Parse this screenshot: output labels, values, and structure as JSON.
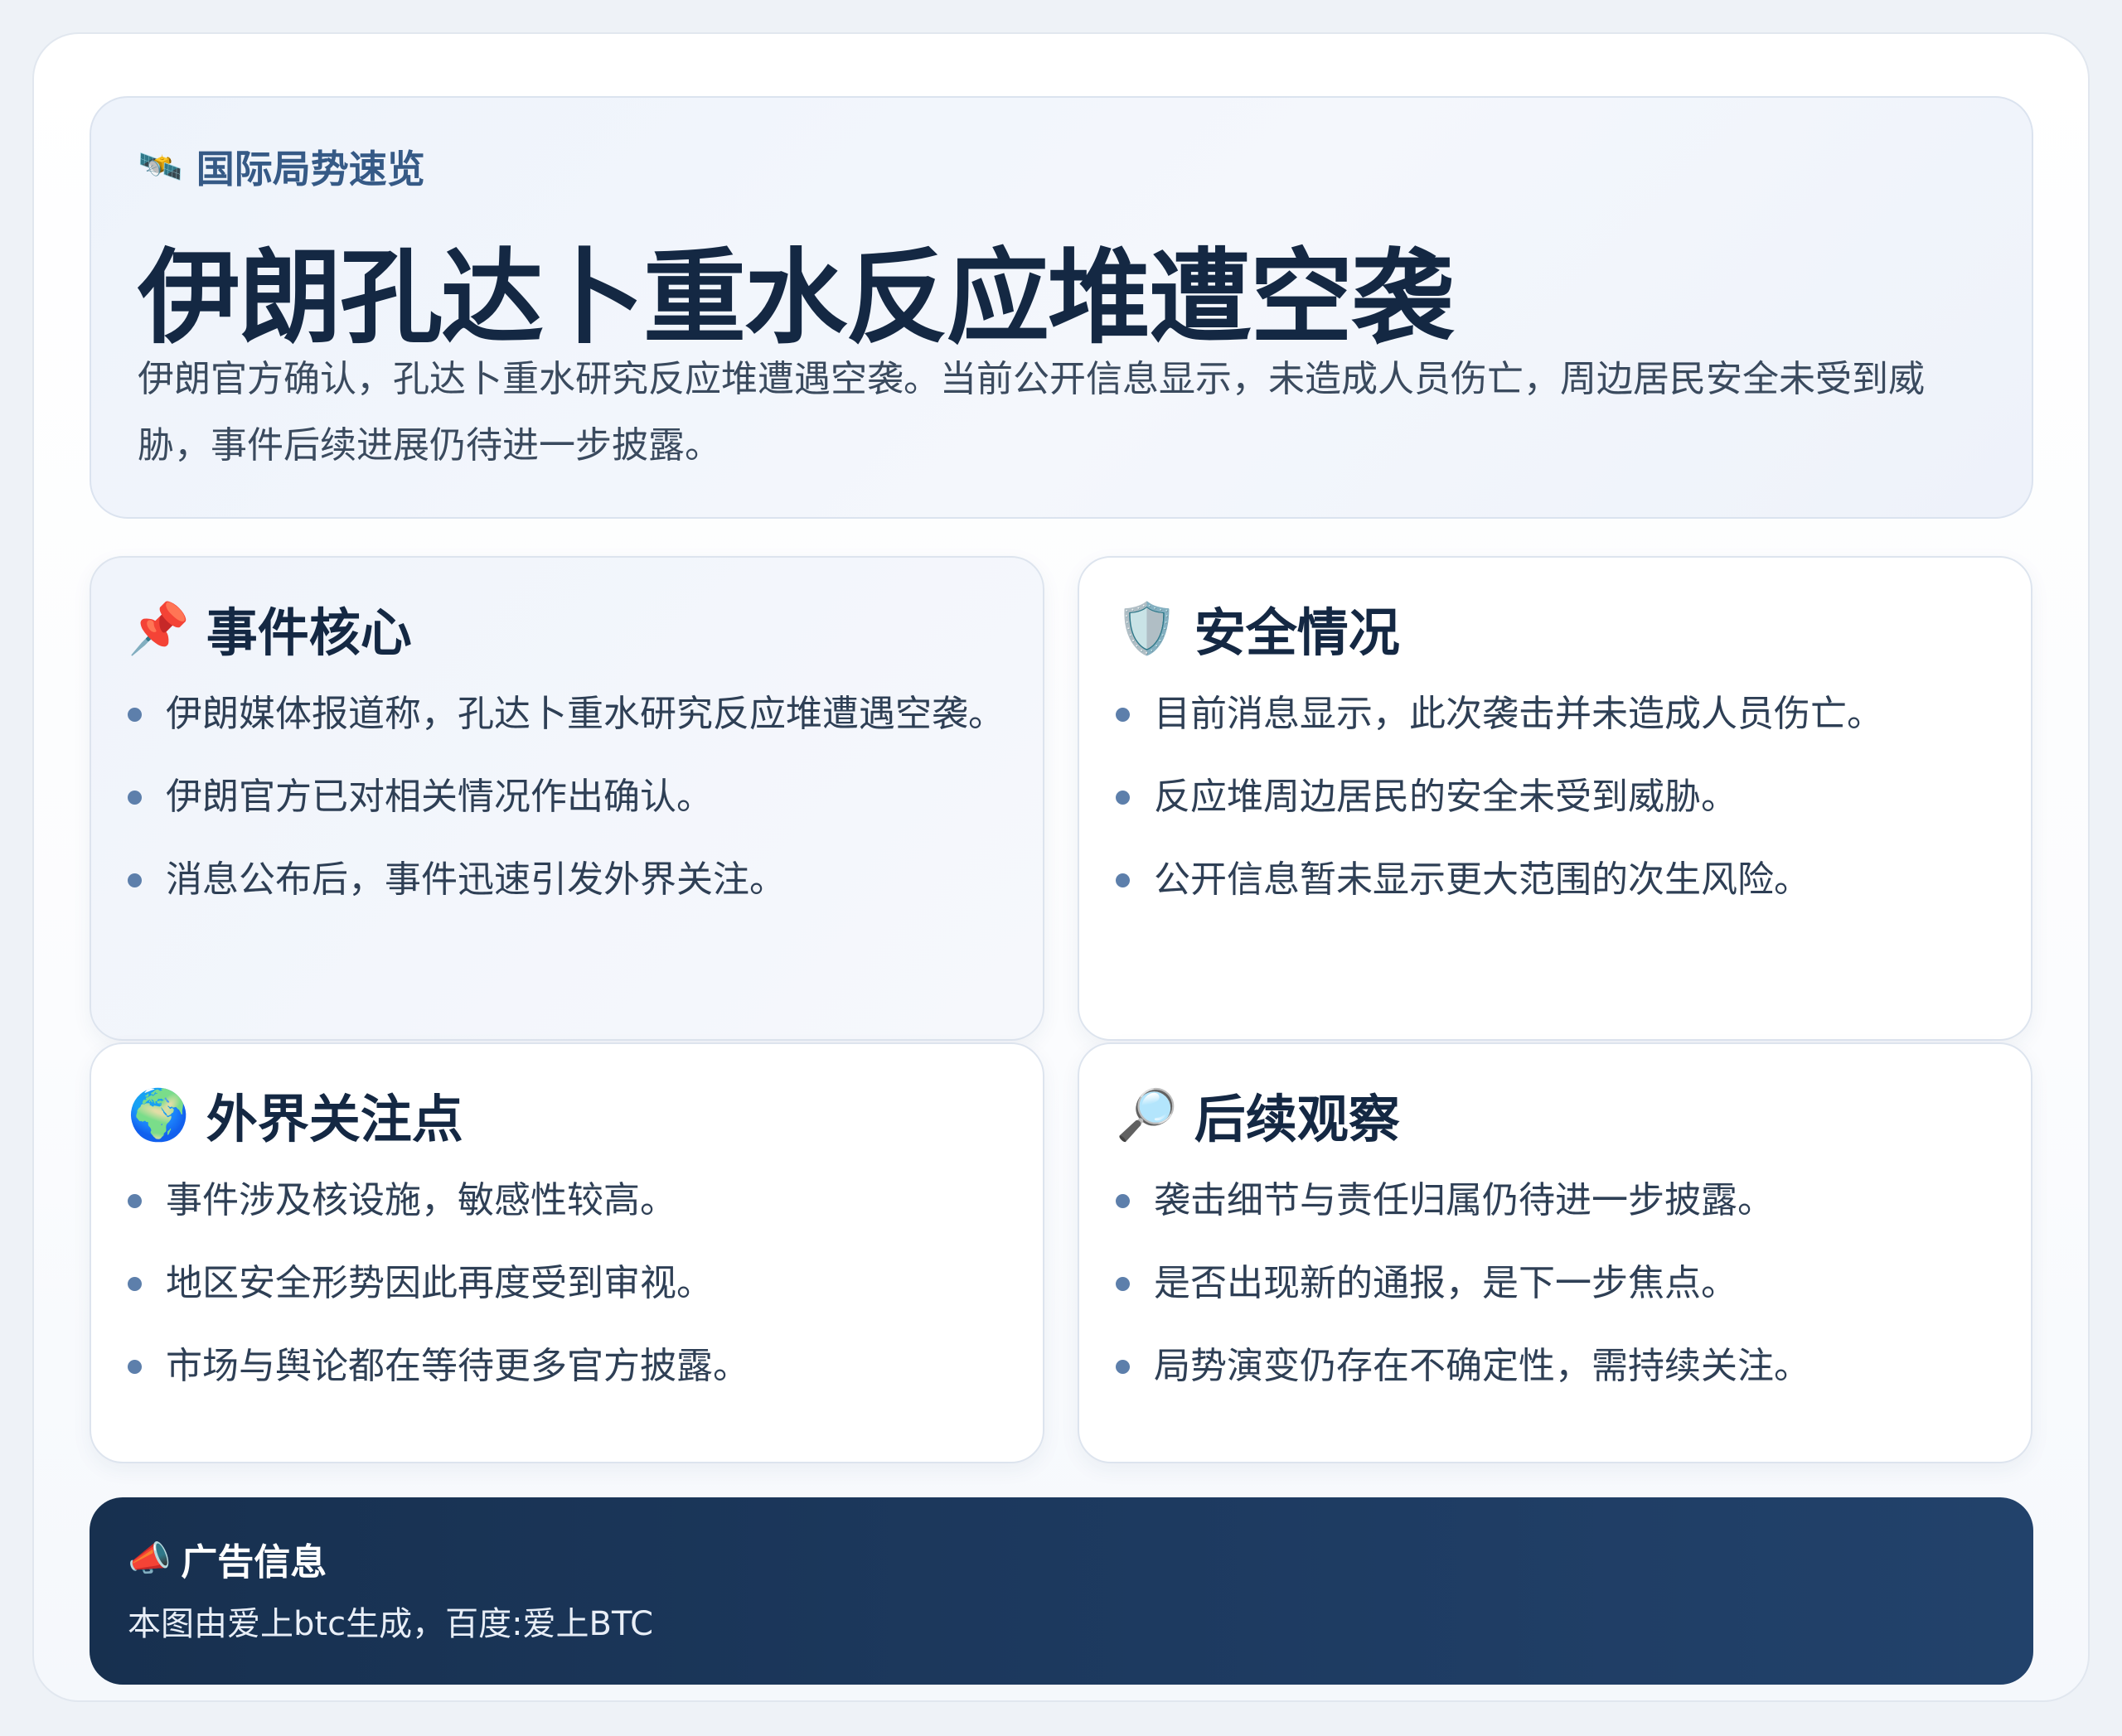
{
  "header": {
    "kicker_icon": "🛰️",
    "kicker": "国际局势速览",
    "title": "伊朗孔达卜重水反应堆遭空袭",
    "description": "伊朗官方确认，孔达卜重水研究反应堆遭遇空袭。当前公开信息显示，未造成人员伤亡，周边居民安全未受到威胁，事件后续进展仍待进一步披露。"
  },
  "cards": [
    {
      "icon": "📌",
      "title": "事件核心",
      "items": [
        "伊朗媒体报道称，孔达卜重水研究反应堆遭遇空袭。",
        "伊朗官方已对相关情况作出确认。",
        "消息公布后，事件迅速引发外界关注。"
      ]
    },
    {
      "icon": "🛡️",
      "title": "安全情况",
      "items": [
        "目前消息显示，此次袭击并未造成人员伤亡。",
        "反应堆周边居民的安全未受到威胁。",
        "公开信息暂未显示更大范围的次生风险。"
      ]
    },
    {
      "icon": "🌍",
      "title": "外界关注点",
      "items": [
        "事件涉及核设施，敏感性较高。",
        "地区安全形势因此再度受到审视。",
        "市场与舆论都在等待更多官方披露。"
      ]
    },
    {
      "icon": "🔎",
      "title": "后续观察",
      "items": [
        "袭击细节与责任归属仍待进一步披露。",
        "是否出现新的通报，是下一步焦点。",
        "局势演变仍存在不确定性，需持续关注。"
      ]
    }
  ],
  "ad": {
    "icon": "📣",
    "title": "广告信息",
    "text": "本图由爱上btc生成，百度:爱上BTC"
  }
}
